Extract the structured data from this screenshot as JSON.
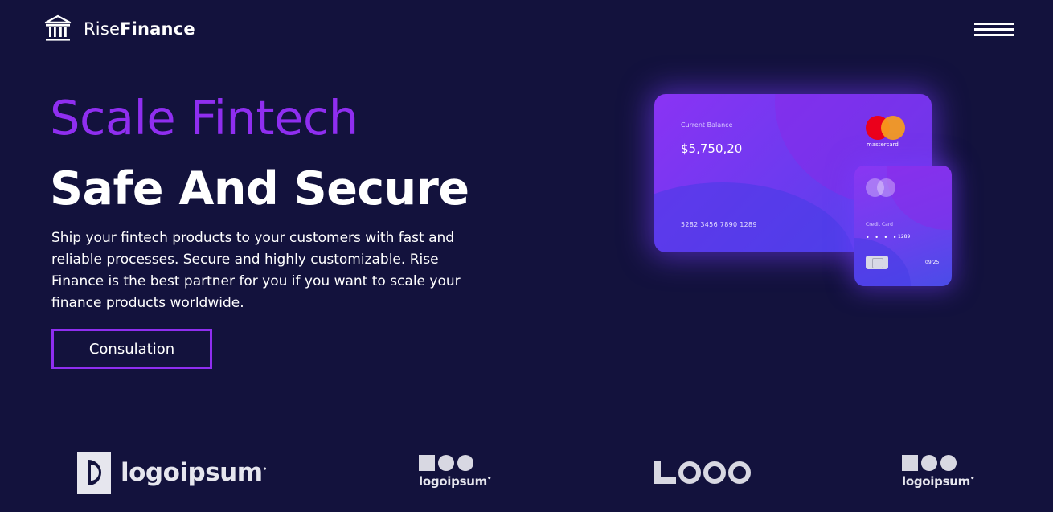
{
  "header": {
    "brand_light": "Rise",
    "brand_bold": "Finance",
    "brand_icon": "bank-columns-icon",
    "menu_icon": "hamburger-menu-icon"
  },
  "hero": {
    "title": "Scale Fintech",
    "subtitle": "Safe And Secure",
    "description": "Ship your fintech products to your customers with fast and reliable processes. Secure and highly customizable. Rise Finance is the best partner for you if you want to scale your finance products worldwide.",
    "cta_label": "Consulation"
  },
  "cards": {
    "main": {
      "label": "Current Balance",
      "balance": "$5,750,20",
      "number": "5282 3456 7890 1289",
      "brand": "mastercard"
    },
    "small": {
      "label": "Credit Card",
      "dots": "• • • •",
      "last4": "1289",
      "expiry": "09/25"
    }
  },
  "logos": {
    "logo1": "logoipsum",
    "logo2": "logoipsum",
    "logo3": "LOGO",
    "logo4": "logoipsum"
  },
  "colors": {
    "background": "#13123d",
    "accent": "#8f2ef0",
    "text": "#ffffff"
  }
}
